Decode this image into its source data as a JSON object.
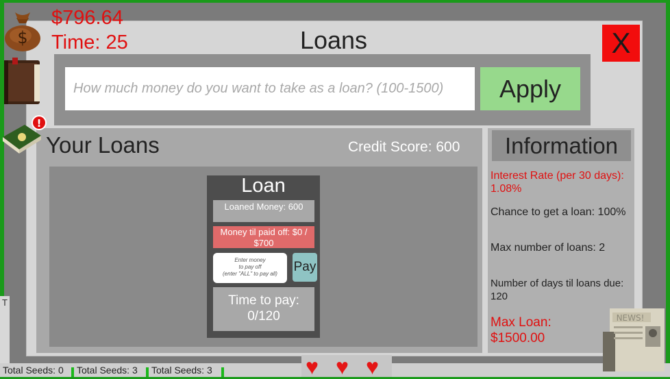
{
  "hud": {
    "money": "$796.64",
    "time": "Time: 25"
  },
  "dialog": {
    "title": "Loans",
    "close_label": "X",
    "loan_input_placeholder": "How much money do you want to take as a loan? (100-1500)",
    "apply_label": "Apply"
  },
  "your_loans": {
    "title": "Your Loans",
    "credit_score": "Credit Score: 600",
    "card": {
      "title": "Loan",
      "loaned_money": "Loaned Money: 600",
      "money_til_paid": "Money til paid off: $0 / $700",
      "pay_placeholder_line1": "Enter money",
      "pay_placeholder_line2": "to pay off",
      "pay_placeholder_line3": "(enter \"ALL\" to pay all)",
      "pay_label": "Pay",
      "time_to_pay_label": "Time to pay:",
      "time_to_pay_value": "0/120"
    }
  },
  "information": {
    "title": "Information",
    "interest_rate": "Interest Rate (per 30 days): 1.08%",
    "chance": "Chance to get a loan: 100%",
    "max_loans": "Max number of loans: 2",
    "days_due": "Number of days til loans due: 120",
    "max_loan_label": "Max Loan:",
    "max_loan_value": "$1500.00"
  },
  "bottom": {
    "seeds": [
      "Total Seeds: 0",
      "Total Seeds: 3",
      "Total Seeds: 3"
    ],
    "left_letter": "T",
    "news_label": "NEWS!"
  },
  "notification_badge": "!",
  "colors": {
    "accent_red": "#e01010",
    "apply_green": "#97d98c",
    "close_red": "#f20d0d"
  }
}
